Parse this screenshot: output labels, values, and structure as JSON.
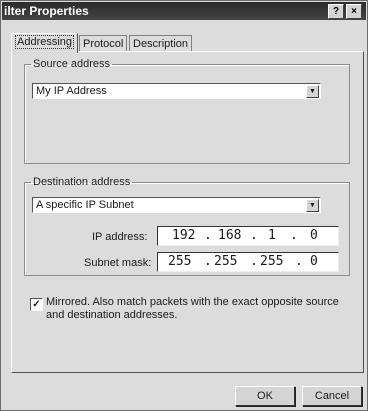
{
  "window": {
    "title": "ilter Properties",
    "help_glyph": "?",
    "close_glyph": "×"
  },
  "tabs": [
    {
      "label": "Addressing",
      "active": true
    },
    {
      "label": "Protocol",
      "active": false
    },
    {
      "label": "Description",
      "active": false
    }
  ],
  "source": {
    "legend": "Source address",
    "selected": "My IP Address"
  },
  "destination": {
    "legend": "Destination address",
    "selected": "A specific IP Subnet",
    "ip_label": "IP address:",
    "ip_octets": [
      "192",
      "168",
      "1",
      "0"
    ],
    "mask_label": "Subnet mask:",
    "mask_octets": [
      "255",
      "255",
      "255",
      "0"
    ]
  },
  "mirrored": {
    "checked": true,
    "text": "Mirrored. Also match packets with the exact opposite source and destination addresses."
  },
  "buttons": {
    "ok": "OK",
    "cancel": "Cancel"
  }
}
